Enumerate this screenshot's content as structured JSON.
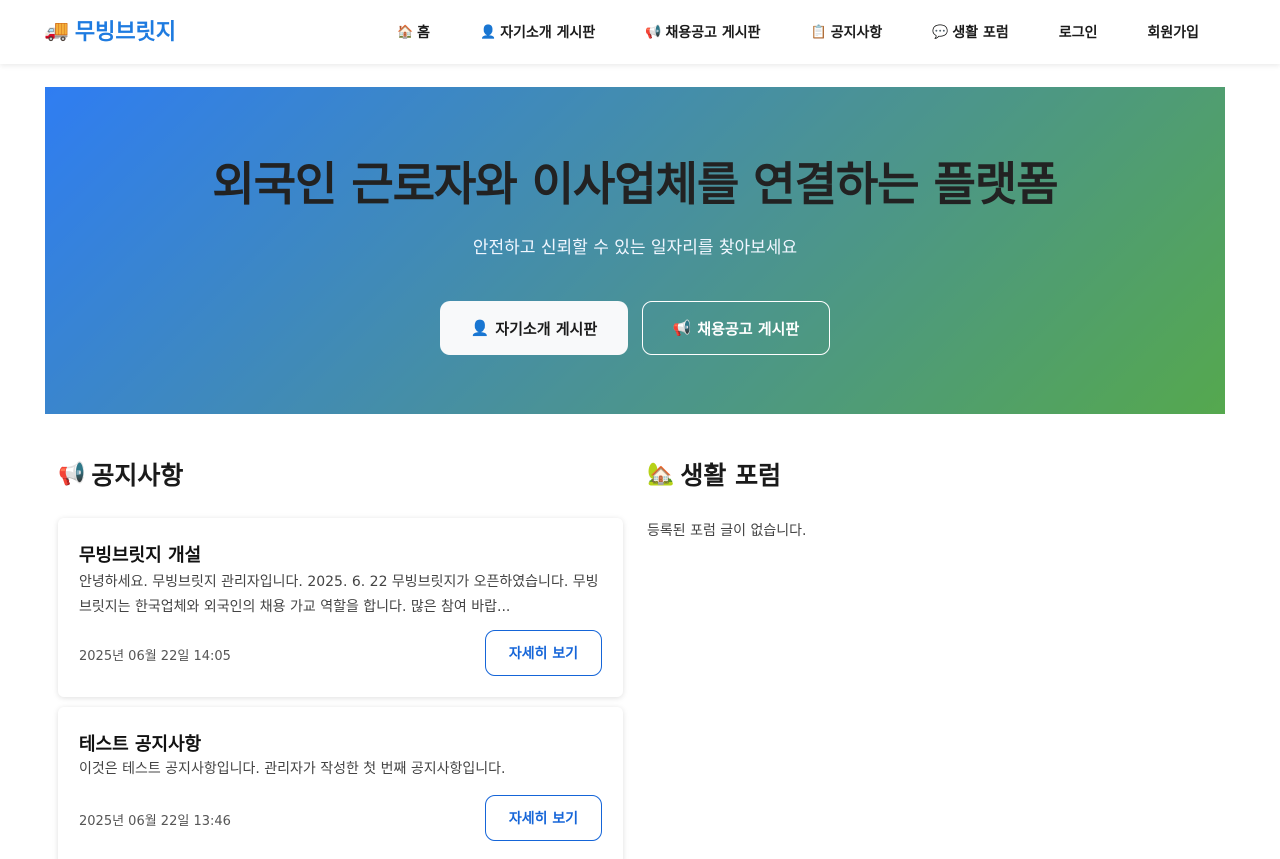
{
  "navbar": {
    "brand": {
      "icon": "🚚",
      "label": "무빙브릿지"
    },
    "links": [
      {
        "icon": "🏠",
        "label": "홈"
      },
      {
        "icon": "👤",
        "label": "자기소개 게시판"
      },
      {
        "icon": "📢",
        "label": "채용공고 게시판"
      },
      {
        "icon": "📋",
        "label": "공지사항"
      },
      {
        "icon": "💬",
        "label": "생활 포럼"
      },
      {
        "icon": "",
        "label": "로그인"
      },
      {
        "icon": "",
        "label": "회원가입"
      }
    ]
  },
  "hero": {
    "title": "외국인 근로자와 이사업체를 연결하는 플랫폼",
    "subtitle": "안전하고 신뢰할 수 있는 일자리를 찾아보세요",
    "primary_button": {
      "icon": "👤",
      "label": "자기소개 게시판"
    },
    "outline_button": {
      "icon": "📢",
      "label": "채용공고 게시판"
    },
    "gradient_colors": [
      "#2f7df2",
      "#55a84e"
    ]
  },
  "notices": {
    "icon": "📢",
    "title": "공지사항",
    "items": [
      {
        "title": "무빙브릿지 개설",
        "body": "안녕하세요. 무빙브릿지 관리자입니다. 2025. 6. 22 무빙브릿지가 오픈하였습니다. 무빙브릿지는 한국업체와 외국인의 채용 가교 역할을 합니다. 많은 참여 바랍...",
        "date": "2025년 06월 22일 14:05",
        "button": "자세히 보기"
      },
      {
        "title": "테스트 공지사항",
        "body": "이것은 테스트 공지사항입니다. 관리자가 작성한 첫 번째 공지사항입니다.",
        "date": "2025년 06월 22일 13:46",
        "button": "자세히 보기"
      }
    ]
  },
  "forum": {
    "icon": "🏡",
    "title": "생활 포럼",
    "empty_text": "등록된 포럼 글이 없습니다."
  },
  "colors": {
    "brand": "#1e7be0",
    "button_outline": "#1565d8"
  }
}
